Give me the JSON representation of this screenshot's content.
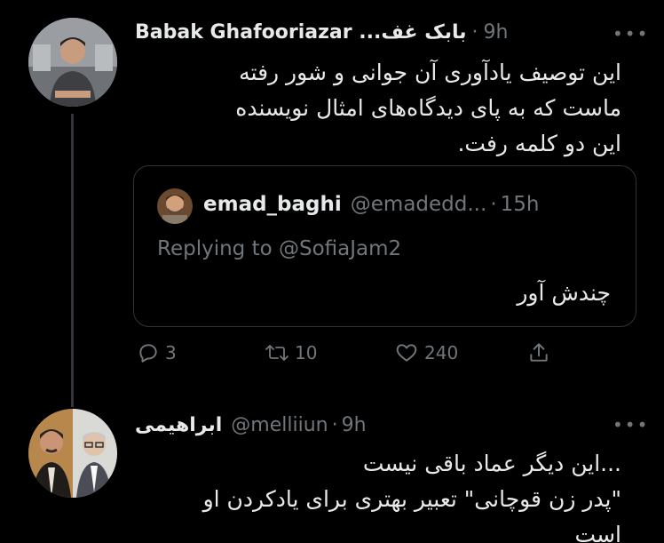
{
  "tweet1": {
    "display_name": "بابک غف... Babak Ghafooriazar",
    "time": "9h",
    "text_lines": [
      "این توصیف یادآوری آن جوانی و شور رفته",
      "ماست که به پای دیدگاه‌های امثال نویسنده",
      "این دو کلمه رفت."
    ],
    "quote": {
      "display_name": "emad_baghi",
      "handle": "@emadedd...",
      "time": "15h",
      "replying_prefix": "Replying to",
      "replying_handle": "@SofiaJam2",
      "text": "چندش آور"
    },
    "actions": {
      "reply_count": "3",
      "retweet_count": "10",
      "like_count": "240"
    }
  },
  "tweet2": {
    "display_name": "ابراهیمی",
    "handle": "@melliiun",
    "time": "9h",
    "text_lines": [
      "...این دیگر عماد باقی نیست",
      "\"پدر زن قوچانی\" تعبیر بهتری برای یادکردن او",
      "است"
    ]
  },
  "icons": {
    "reply": "reply-icon",
    "retweet": "retweet-icon",
    "like": "heart-icon",
    "share": "share-icon",
    "more": "more-icon"
  },
  "colors": {
    "background": "#000000",
    "text": "#e7e9ea",
    "muted": "#71767b",
    "border": "#2f3336"
  }
}
